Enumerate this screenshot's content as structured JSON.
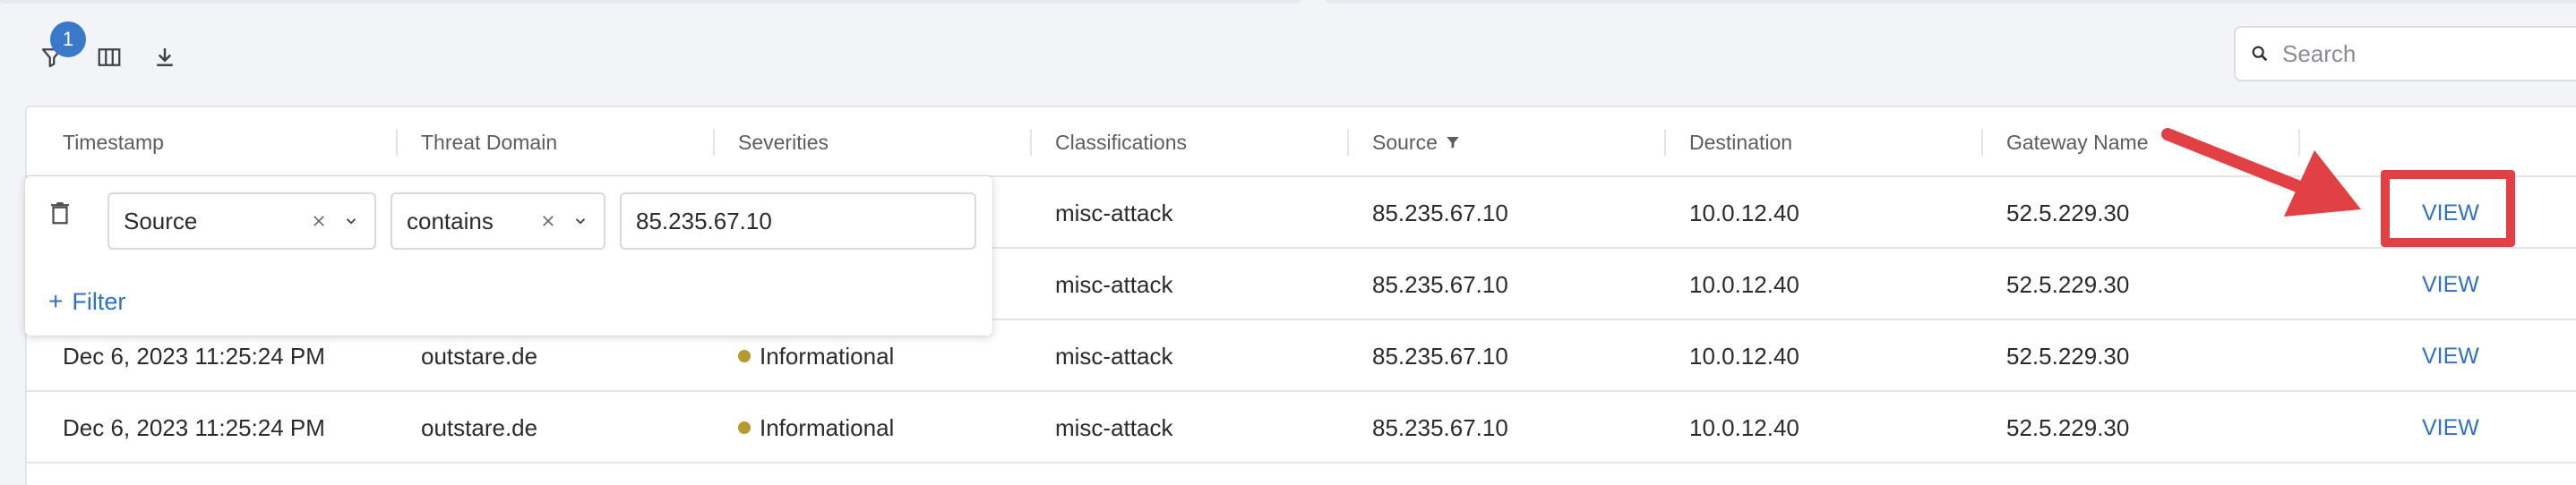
{
  "toolbar": {
    "filter_count": "1",
    "search_placeholder": "Search"
  },
  "table": {
    "columns": [
      "Timestamp",
      "Threat Domain",
      "Severities",
      "Classifications",
      "Source",
      "Destination",
      "Gateway Name"
    ],
    "rows": [
      {
        "timestamp": "",
        "domain": "",
        "severity": "",
        "classification": "misc-attack",
        "source": "85.235.67.10",
        "destination": "10.0.12.40",
        "gateway": "52.5.229.30",
        "action": "VIEW"
      },
      {
        "timestamp": "",
        "domain": "",
        "severity": "",
        "classification": "misc-attack",
        "source": "85.235.67.10",
        "destination": "10.0.12.40",
        "gateway": "52.5.229.30",
        "action": "VIEW"
      },
      {
        "timestamp": "Dec 6, 2023 11:25:24 PM",
        "domain": "outstare.de",
        "severity": "Informational",
        "classification": "misc-attack",
        "source": "85.235.67.10",
        "destination": "10.0.12.40",
        "gateway": "52.5.229.30",
        "action": "VIEW"
      },
      {
        "timestamp": "Dec 6, 2023 11:25:24 PM",
        "domain": "outstare.de",
        "severity": "Informational",
        "classification": "misc-attack",
        "source": "85.235.67.10",
        "destination": "10.0.12.40",
        "gateway": "52.5.229.30",
        "action": "VIEW"
      }
    ]
  },
  "filter_popover": {
    "field": "Source",
    "operator": "contains",
    "value": "85.235.67.10",
    "add_filter_label": "Filter",
    "add_filter_plus": "+"
  },
  "colors": {
    "accent": "#2f72c4",
    "badge": "#3a78c9",
    "severity_informational": "#b79a2f",
    "annotation": "#e14144"
  },
  "icons": {
    "filter": "filter-icon",
    "columns": "columns-icon",
    "download": "download-icon",
    "search": "search-icon",
    "trash": "trash-icon"
  }
}
